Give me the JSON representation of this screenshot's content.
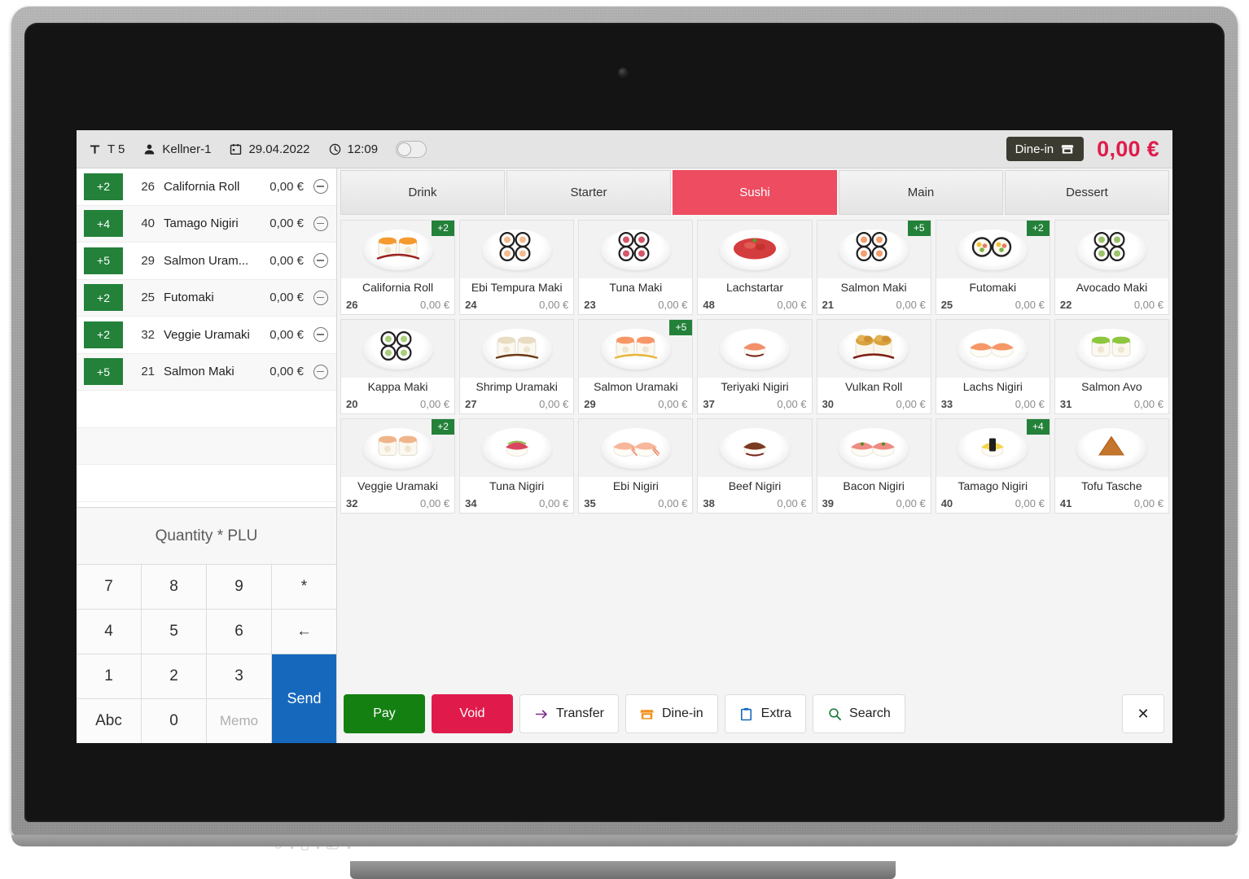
{
  "header": {
    "table_icon": "table-icon",
    "table_label": "T 5",
    "waiter_icon": "person-icon",
    "waiter": "Kellner-1",
    "calendar_icon": "calendar-icon",
    "date": "29.04.2022",
    "clock_icon": "clock-icon",
    "time": "12:09",
    "toggle_state": "off",
    "service_mode": "Dine-in",
    "service_mode_icon": "store-icon",
    "total": "0,00 €",
    "total_color": "#e01b4c"
  },
  "order": {
    "rows": [
      {
        "qty": "+2",
        "plu": "26",
        "name": "California Roll",
        "price": "0,00 €"
      },
      {
        "qty": "+4",
        "plu": "40",
        "name": "Tamago Nigiri",
        "price": "0,00 €"
      },
      {
        "qty": "+5",
        "plu": "29",
        "name": "Salmon Uram...",
        "price": "0,00 €"
      },
      {
        "qty": "+2",
        "plu": "25",
        "name": "Futomaki",
        "price": "0,00 €"
      },
      {
        "qty": "+2",
        "plu": "32",
        "name": "Veggie Uramaki",
        "price": "0,00 €"
      },
      {
        "qty": "+5",
        "plu": "21",
        "name": "Salmon Maki",
        "price": "0,00 €"
      }
    ],
    "badge_color": "#23813a",
    "remove_icon": "minus-circle-icon"
  },
  "keypad": {
    "label": "Quantity * PLU",
    "keys": [
      {
        "label": "7",
        "type": "digit"
      },
      {
        "label": "8",
        "type": "digit"
      },
      {
        "label": "9",
        "type": "digit"
      },
      {
        "label": "*",
        "type": "op"
      },
      {
        "label": "4",
        "type": "digit"
      },
      {
        "label": "5",
        "type": "digit"
      },
      {
        "label": "6",
        "type": "digit"
      },
      {
        "label": "←",
        "type": "backspace"
      },
      {
        "label": "1",
        "type": "digit"
      },
      {
        "label": "2",
        "type": "digit"
      },
      {
        "label": "3",
        "type": "digit"
      },
      {
        "label": "Abc",
        "type": "alpha"
      },
      {
        "label": "0",
        "type": "digit"
      },
      {
        "label": "Memo",
        "type": "memo"
      }
    ],
    "send_label": "Send",
    "send_color": "#1668bd"
  },
  "tabs": [
    {
      "label": "Drink",
      "active": false
    },
    {
      "label": "Starter",
      "active": false
    },
    {
      "label": "Sushi",
      "active": true
    },
    {
      "label": "Main",
      "active": false
    },
    {
      "label": "Dessert",
      "active": false
    }
  ],
  "tab_active_color": "#ed4c61",
  "products": {
    "rows": [
      [
        {
          "name": "California Roll",
          "plu": "26",
          "price": "0,00 €",
          "badge": "+2",
          "food": "uramaki-pair-orange"
        },
        {
          "name": "Ebi Tempura Maki",
          "plu": "24",
          "price": "0,00 €",
          "badge": "",
          "food": "maki-quad-shrimp"
        },
        {
          "name": "Tuna Maki",
          "plu": "23",
          "price": "0,00 €",
          "badge": "",
          "food": "maki-quad-tuna"
        },
        {
          "name": "Lachstartar",
          "plu": "48",
          "price": "0,00 €",
          "badge": "",
          "food": "tartar-bowl"
        },
        {
          "name": "Salmon Maki",
          "plu": "21",
          "price": "0,00 €",
          "badge": "+5",
          "food": "maki-quad-salmon"
        },
        {
          "name": "Futomaki",
          "plu": "25",
          "price": "0,00 €",
          "badge": "+2",
          "food": "futomaki-pair"
        },
        {
          "name": "Avocado Maki",
          "plu": "22",
          "price": "0,00 €",
          "badge": "",
          "food": "maki-quad-avocado"
        }
      ],
      [
        {
          "name": "Kappa Maki",
          "plu": "20",
          "price": "0,00 €",
          "badge": "",
          "food": "maki-quad-cucumber"
        },
        {
          "name": "Shrimp Uramaki",
          "plu": "27",
          "price": "0,00 €",
          "badge": "",
          "food": "uramaki-pair-sesame"
        },
        {
          "name": "Salmon Uramaki",
          "plu": "29",
          "price": "0,00 €",
          "badge": "+5",
          "food": "uramaki-pair-salmon"
        },
        {
          "name": "Teriyaki Nigiri",
          "plu": "37",
          "price": "0,00 €",
          "badge": "",
          "food": "nigiri-teriyaki"
        },
        {
          "name": "Vulkan Roll",
          "plu": "30",
          "price": "0,00 €",
          "badge": "",
          "food": "vulkan-roll"
        },
        {
          "name": "Lachs Nigiri",
          "plu": "33",
          "price": "0,00 €",
          "badge": "",
          "food": "nigiri-salmon-pair"
        },
        {
          "name": "Salmon Avo",
          "plu": "31",
          "price": "0,00 €",
          "badge": "",
          "food": "uramaki-pair-green"
        }
      ],
      [
        {
          "name": "Veggie Uramaki",
          "plu": "32",
          "price": "0,00 €",
          "badge": "+2",
          "food": "uramaki-pair-veggie"
        },
        {
          "name": "Tuna Nigiri",
          "plu": "34",
          "price": "0,00 €",
          "badge": "",
          "food": "nigiri-tuna"
        },
        {
          "name": "Ebi Nigiri",
          "plu": "35",
          "price": "0,00 €",
          "badge": "",
          "food": "nigiri-ebi"
        },
        {
          "name": "Beef Nigiri",
          "plu": "38",
          "price": "0,00 €",
          "badge": "",
          "food": "nigiri-beef"
        },
        {
          "name": "Bacon Nigiri",
          "plu": "39",
          "price": "0,00 €",
          "badge": "",
          "food": "nigiri-bacon"
        },
        {
          "name": "Tamago Nigiri",
          "plu": "40",
          "price": "0,00 €",
          "badge": "+4",
          "food": "nigiri-tamago"
        },
        {
          "name": "Tofu Tasche",
          "plu": "41",
          "price": "0,00 €",
          "badge": "",
          "food": "tofu-pocket"
        }
      ]
    ],
    "badge_color": "#23813a"
  },
  "actions": {
    "pay": "Pay",
    "pay_color": "#158012",
    "void": "Void",
    "void_color": "#e01b4c",
    "transfer": "Transfer",
    "transfer_icon": "arrow-right-icon",
    "dinein": "Dine-in",
    "dinein_icon": "store-icon",
    "extra": "Extra",
    "extra_icon": "clipboard-icon",
    "search": "Search",
    "search_icon": "magnifier-icon",
    "close": "✕",
    "close_icon": "close-icon"
  },
  "device": {
    "power_icon": "power-icon",
    "drive_icon": "drive-icon",
    "battery_icon": "battery-icon"
  }
}
